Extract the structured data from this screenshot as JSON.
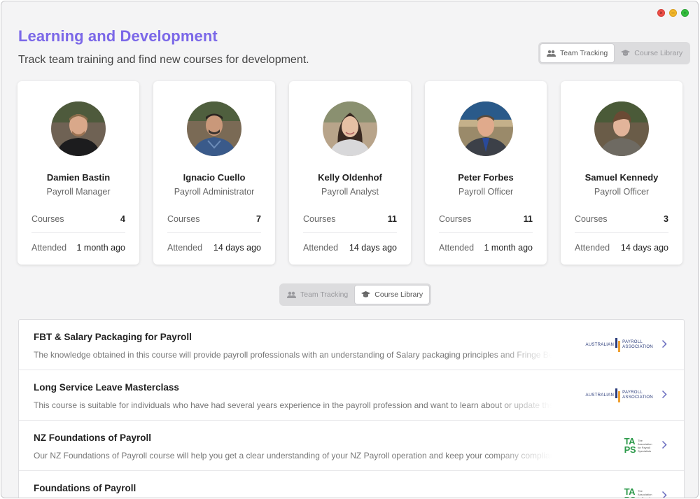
{
  "header": {
    "title": "Learning and Development",
    "subtitle": "Track team training and find new courses for development."
  },
  "view_toggle": {
    "team_tracking": "Team Tracking",
    "course_library": "Course Library"
  },
  "team": [
    {
      "name": "Damien Bastin",
      "role": "Payroll Manager",
      "courses_label": "Courses",
      "courses": "4",
      "attended_label": "Attended",
      "attended": "1 month ago"
    },
    {
      "name": "Ignacio Cuello",
      "role": "Payroll Administrator",
      "courses_label": "Courses",
      "courses": "7",
      "attended_label": "Attended",
      "attended": "14 days ago"
    },
    {
      "name": "Kelly Oldenhof",
      "role": "Payroll Analyst",
      "courses_label": "Courses",
      "courses": "11",
      "attended_label": "Attended",
      "attended": "14 days ago"
    },
    {
      "name": "Peter Forbes",
      "role": "Payroll Officer",
      "courses_label": "Courses",
      "courses": "11",
      "attended_label": "Attended",
      "attended": "1 month ago"
    },
    {
      "name": "Samuel Kennedy",
      "role": "Payroll Officer",
      "courses_label": "Courses",
      "courses": "3",
      "attended_label": "Attended",
      "attended": "14 days ago"
    }
  ],
  "courses": [
    {
      "title": "FBT & Salary Packaging for Payroll",
      "description": "The knowledge obtained in this course will provide payroll professionals with an understanding of Salary packaging principles and Fringe Benefits Tax",
      "provider": "APA",
      "provider_lines": [
        "AUSTRALIAN",
        "PAYROLL",
        "ASSOCIATION"
      ]
    },
    {
      "title": "Long Service Leave Masterclass",
      "description": "This course is suitable for individuals who have had several years experience in the payroll profession and want to learn about or update their knowledge",
      "provider": "APA",
      "provider_lines": [
        "AUSTRALIAN",
        "PAYROLL",
        "ASSOCIATION"
      ]
    },
    {
      "title": "NZ Foundations of Payroll",
      "description": "Our NZ Foundations of Payroll course will help you get a clear understanding of your NZ Payroll operation and keep your company compliant",
      "provider": "TAPS",
      "provider_lines": [
        "TA",
        "PS",
        "The Association for Payroll Specialists"
      ]
    },
    {
      "title": "Foundations of Payroll",
      "description": "",
      "provider": "TAPS",
      "provider_lines": [
        "TA",
        "PS",
        "The Association for Payroll Specialists"
      ]
    }
  ],
  "colors": {
    "accent": "#7b68e8",
    "window_bg": "#f4f4f5",
    "apa_blue": "#2a3b7a",
    "apa_orange": "#f0a030",
    "taps_green": "#2c9a4a"
  }
}
